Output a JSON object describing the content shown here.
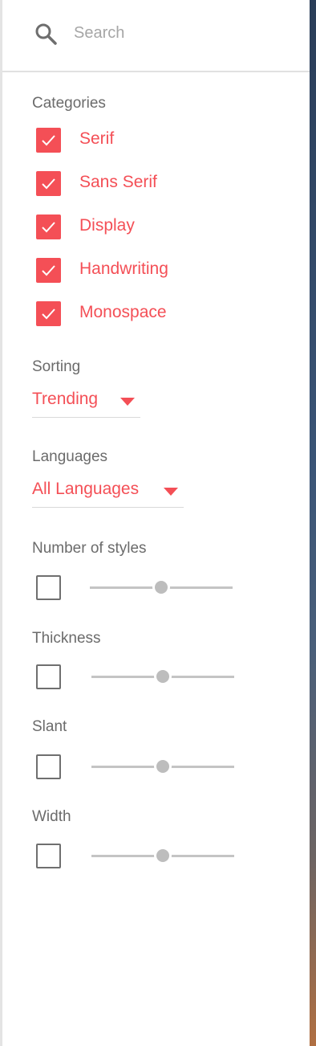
{
  "search": {
    "placeholder": "Search"
  },
  "categories": {
    "title": "Categories",
    "items": [
      {
        "label": "Serif",
        "checked": true
      },
      {
        "label": "Sans Serif",
        "checked": true
      },
      {
        "label": "Display",
        "checked": true
      },
      {
        "label": "Handwriting",
        "checked": true
      },
      {
        "label": "Monospace",
        "checked": true
      }
    ]
  },
  "sorting": {
    "title": "Sorting",
    "value": "Trending"
  },
  "languages": {
    "title": "Languages",
    "value": "All Languages"
  },
  "filters": [
    {
      "title": "Number of styles",
      "enabled": false,
      "level": 0.5
    },
    {
      "title": "Thickness",
      "enabled": false,
      "level": 0.5
    },
    {
      "title": "Slant",
      "enabled": false,
      "level": 0.5
    },
    {
      "title": "Width",
      "enabled": false,
      "level": 0.5
    }
  ],
  "colors": {
    "accent": "#f44f56",
    "muted_text": "#6b6b6b",
    "track": "#c4c4c4"
  },
  "icons": {
    "search": "search-icon",
    "check": "check-icon",
    "dropdown": "caret-down-icon"
  }
}
